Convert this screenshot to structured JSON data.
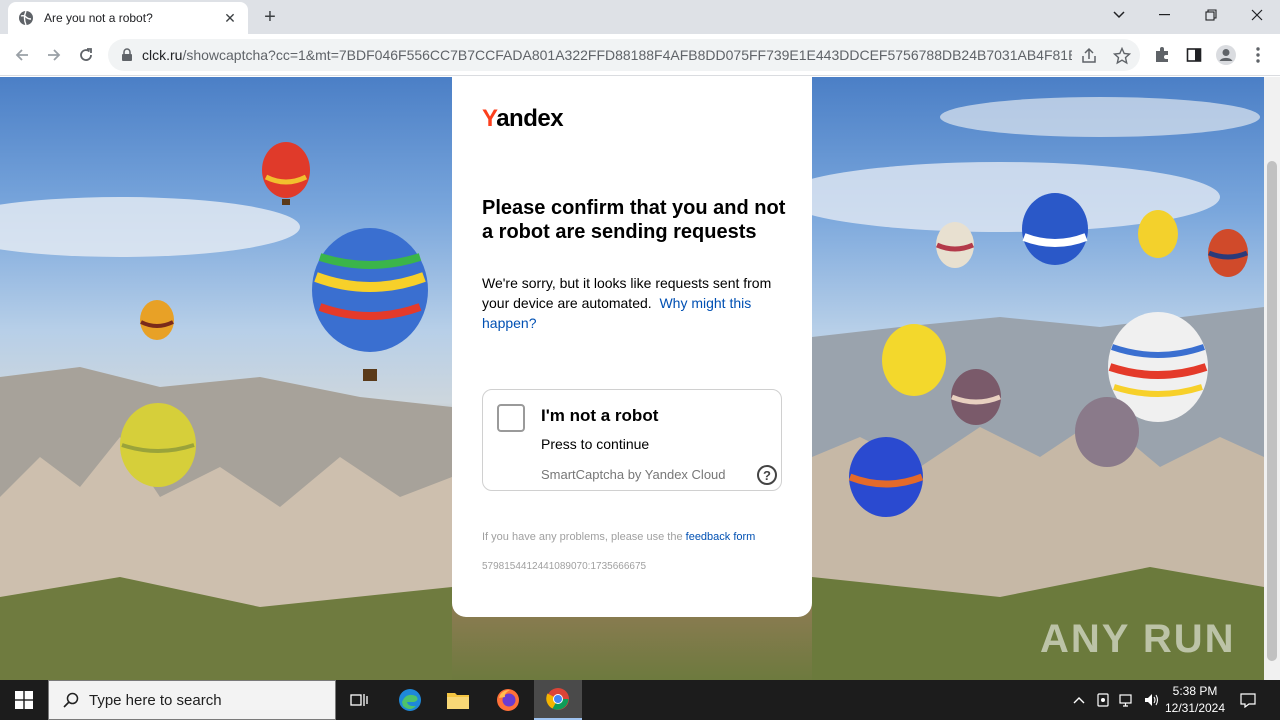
{
  "browser": {
    "tab_title": "Are you not a robot?",
    "new_tab_label": "+",
    "url_host": "clck.ru",
    "url_path": "/showcaptcha?cc=1&mt=7BDF046F556CC7B7CCFADA801A322FFD88188F4AFB8DD075FF739E1E443DDCEF5756788DB24B7031AB4F81E77..."
  },
  "card": {
    "logo_first": "Y",
    "logo_rest": "andex",
    "headline": "Please confirm that you and not a robot are sending requests",
    "description": "We're sorry, but it looks like requests sent from your device are automated.",
    "why_link": "Why might this happen?",
    "captcha": {
      "title": "I'm not a robot",
      "subtitle": "Press to continue",
      "brand": "SmartCaptcha by Yandex Cloud",
      "help_label": "?"
    },
    "footer_text": "If you have any problems, please use the",
    "feedback_link": "feedback form",
    "request_id": "5798154412441089070:1735666675"
  },
  "watermark": "ANY RUN",
  "taskbar": {
    "search_placeholder": "Type here to search",
    "time": "5:38 PM",
    "date": "12/31/2024"
  }
}
